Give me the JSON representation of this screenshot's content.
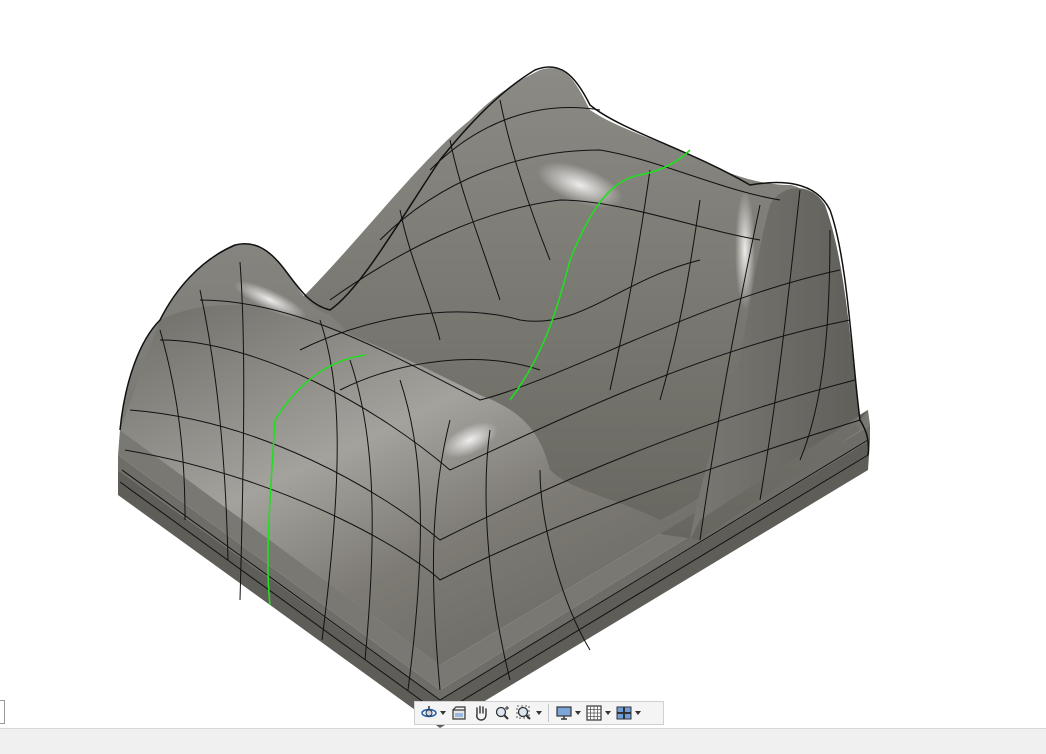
{
  "viewport": {
    "background": "#ffffff",
    "model": {
      "surface_color": "#7d7a72",
      "edge_color": "#111111",
      "selected_edge_color": "#22dd22"
    }
  },
  "navigation_bar": {
    "items": [
      {
        "name": "orbit",
        "icon": "orbit-icon",
        "has_dropdown": true
      },
      {
        "name": "look-at",
        "icon": "look-at-icon",
        "has_dropdown": false
      },
      {
        "name": "pan",
        "icon": "hand-pan-icon",
        "has_dropdown": false
      },
      {
        "name": "zoom",
        "icon": "zoom-icon",
        "has_dropdown": false
      },
      {
        "name": "fit",
        "icon": "zoom-fit-icon",
        "has_dropdown": true
      },
      {
        "name": "display-settings",
        "icon": "monitor-icon",
        "has_dropdown": true
      },
      {
        "name": "grid-snaps",
        "icon": "grid-icon",
        "has_dropdown": true
      },
      {
        "name": "viewports",
        "icon": "viewports-icon",
        "has_dropdown": true
      }
    ]
  }
}
